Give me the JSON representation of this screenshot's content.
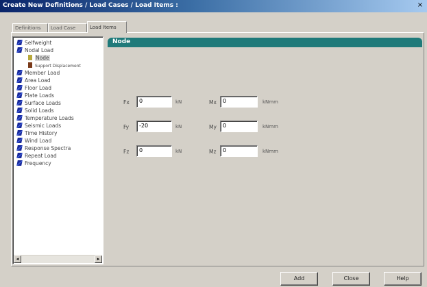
{
  "window": {
    "title": "Create New Definitions / Load Cases / Load Items :",
    "close_label": "×"
  },
  "tabs": [
    {
      "label": "Definitions",
      "active": false
    },
    {
      "label": "Load Case",
      "active": false
    },
    {
      "label": "Load Items",
      "active": true
    }
  ],
  "tree": {
    "items": [
      {
        "label": "Selfweight",
        "icon": "load-icon",
        "level": 0
      },
      {
        "label": "Nodal Load",
        "icon": "load-icon",
        "level": 0
      },
      {
        "label": "Node",
        "icon": "node-icon",
        "level": 1,
        "selected": true
      },
      {
        "label": "Support Displacement",
        "icon": "support-icon",
        "level": 1
      },
      {
        "label": "Member Load",
        "icon": "load-icon",
        "level": 0
      },
      {
        "label": "Area Load",
        "icon": "load-icon",
        "level": 0
      },
      {
        "label": "Floor Load",
        "icon": "load-icon",
        "level": 0
      },
      {
        "label": "Plate Loads",
        "icon": "load-icon",
        "level": 0
      },
      {
        "label": "Surface Loads",
        "icon": "load-icon",
        "level": 0
      },
      {
        "label": "Solid Loads",
        "icon": "load-icon",
        "level": 0
      },
      {
        "label": "Temperature Loads",
        "icon": "load-icon",
        "level": 0
      },
      {
        "label": "Seismic Loads",
        "icon": "load-icon",
        "level": 0
      },
      {
        "label": "Time History",
        "icon": "load-icon",
        "level": 0
      },
      {
        "label": "Wind Load",
        "icon": "load-icon",
        "level": 0
      },
      {
        "label": "Response Spectra",
        "icon": "load-icon",
        "level": 0
      },
      {
        "label": "Repeat Load",
        "icon": "load-icon",
        "level": 0
      },
      {
        "label": "Frequency",
        "icon": "load-icon",
        "level": 0
      }
    ],
    "scroll_left": "◂",
    "scroll_right": "▸"
  },
  "panel": {
    "title": "Node",
    "force": {
      "fx_label": "Fx",
      "fx_value": "0",
      "fx_unit": "kN",
      "fy_label": "Fy",
      "fy_value": "-20",
      "fy_unit": "kN",
      "fz_label": "Fz",
      "fz_value": "0",
      "fz_unit": "kN"
    },
    "moment": {
      "mx_label": "Mx",
      "mx_value": "0",
      "mx_unit": "kNmm",
      "my_label": "My",
      "my_value": "0",
      "my_unit": "kNmm",
      "mz_label": "Mz",
      "mz_value": "0",
      "mz_unit": "kNmm"
    }
  },
  "buttons": {
    "add": "Add",
    "close": "Close",
    "help": "Help"
  },
  "colors": {
    "title_start": "#0a246a",
    "panel_header": "#1f7a7a",
    "dialog_bg": "#d4d0c8"
  }
}
